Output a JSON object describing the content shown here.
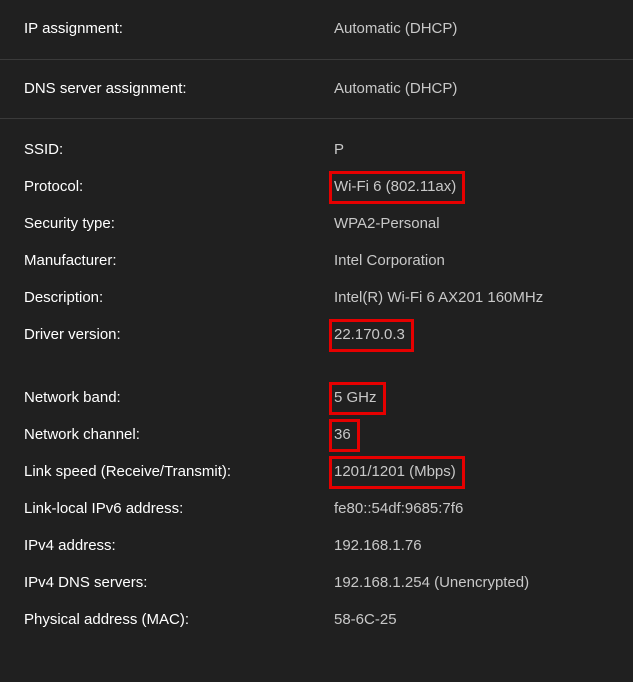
{
  "assignment": {
    "ip_label": "IP assignment:",
    "ip_value": "Automatic (DHCP)",
    "dns_label": "DNS server assignment:",
    "dns_value": "Automatic (DHCP)"
  },
  "props1": {
    "ssid_label": "SSID:",
    "ssid_value": "P",
    "protocol_label": "Protocol:",
    "protocol_value": "Wi-Fi 6 (802.11ax)",
    "security_label": "Security type:",
    "security_value": "WPA2-Personal",
    "manufacturer_label": "Manufacturer:",
    "manufacturer_value": "Intel Corporation",
    "description_label": "Description:",
    "description_value": "Intel(R) Wi-Fi 6 AX201 160MHz",
    "driver_label": "Driver version:",
    "driver_value": "22.170.0.3"
  },
  "props2": {
    "band_label": "Network band:",
    "band_value": "5 GHz",
    "channel_label": "Network channel:",
    "channel_value": "36",
    "link_label": "Link speed (Receive/Transmit):",
    "link_value": "1201/1201 (Mbps)",
    "ipv6local_label": "Link-local IPv6 address:",
    "ipv6local_value": "fe80::54df:9685:7f6",
    "ipv4_label": "IPv4 address:",
    "ipv4_value": "192.168.1.76",
    "dns_label": "IPv4 DNS servers:",
    "dns_value": "192.168.1.254 (Unencrypted)",
    "mac_label": "Physical address (MAC):",
    "mac_value": "58-6C-25"
  },
  "highlights": {
    "protocol": true,
    "driver": true,
    "band": true,
    "channel": true,
    "link": true
  }
}
